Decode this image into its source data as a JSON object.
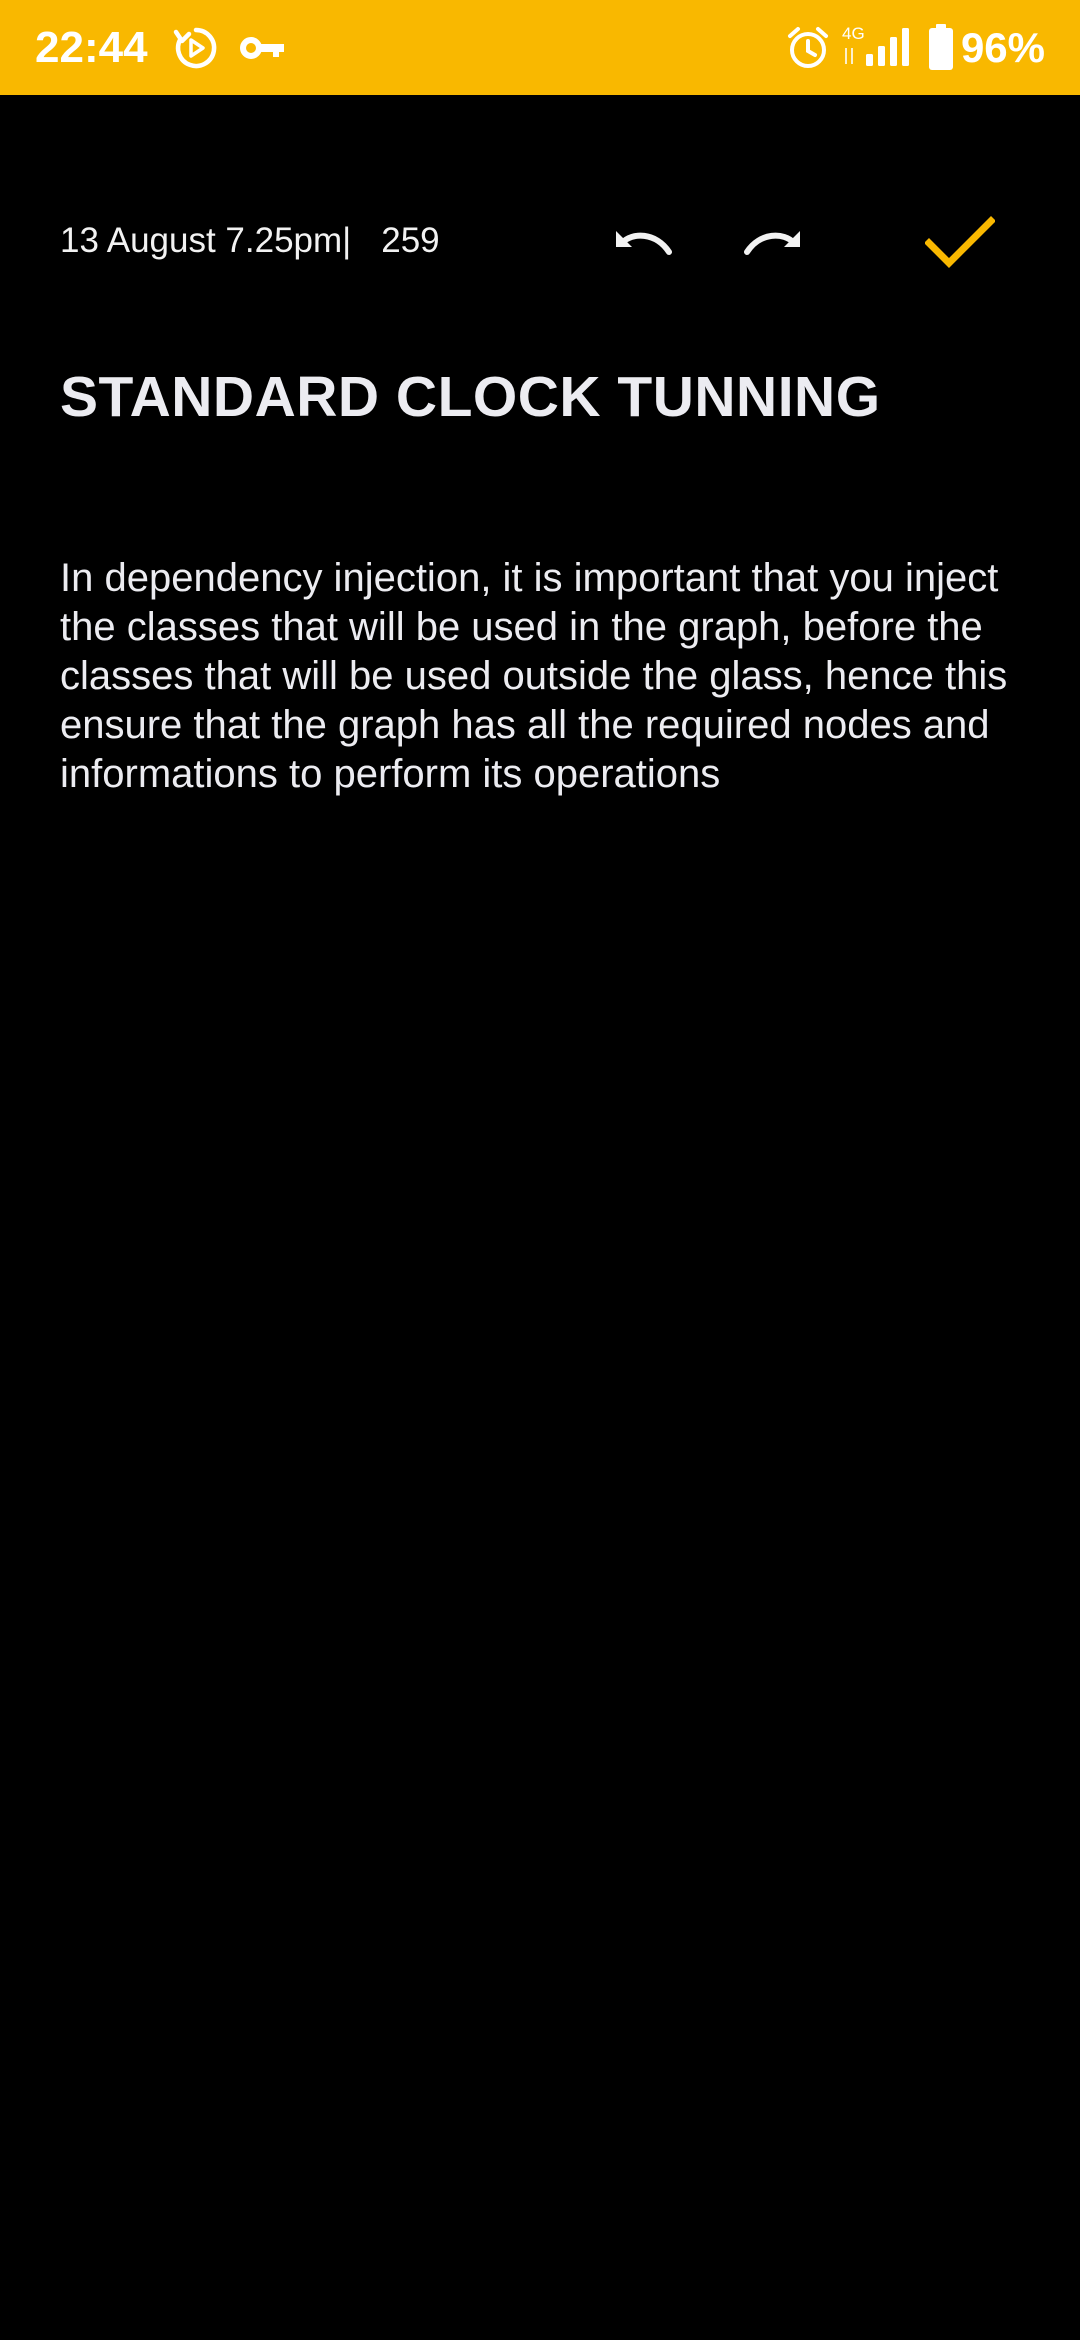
{
  "status_bar": {
    "time": "22:44",
    "network_type": "4G",
    "battery": "96%",
    "background_color": "#f9b800",
    "icons": [
      "replay-icon",
      "vpn-key-icon",
      "alarm-icon",
      "signal-icon",
      "battery-icon"
    ]
  },
  "toolbar": {
    "date": "13 August 7.25pm",
    "separator": "|",
    "char_count": "259",
    "undo_icon": "undo-icon",
    "redo_icon": "redo-icon",
    "save_icon": "check-icon",
    "accent_color": "#f9b800"
  },
  "note": {
    "title": "STANDARD CLOCK TUNNING",
    "body": "In dependency injection, it is important that you inject the classes that will be used in the graph, before the classes that will be used outside the glass, hence this ensure that the graph has all the required nodes and informations to perform its operations"
  }
}
